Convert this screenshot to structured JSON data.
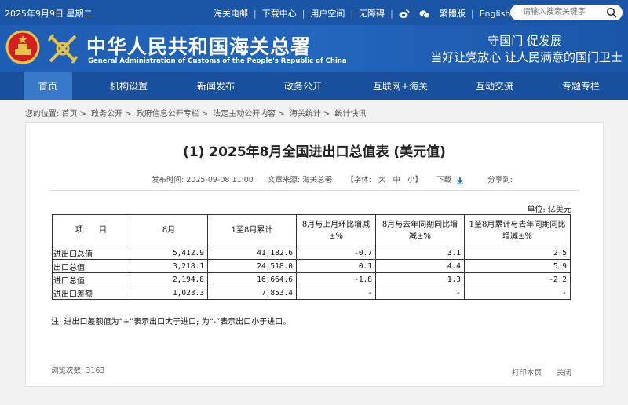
{
  "topbar": {
    "date": "2025年9月9日 星期二",
    "links": [
      "海关电邮",
      "下载中心",
      "用户空间",
      "无障碍"
    ],
    "lang_label": "繁體版",
    "english_label": "English",
    "search_placeholder": "请输入搜索关键字"
  },
  "header": {
    "title_cn": "中华人民共和国海关总署",
    "title_en": "General Administration of Customs of the People's Republic of China",
    "slogan_line1": "守国门  促发展",
    "slogan_line2": "当好让党放心  让人民满意的国门卫士"
  },
  "nav": {
    "items": [
      "首页",
      "机构设置",
      "新闻发布",
      "政务公开",
      "互联网+海关",
      "互动交流",
      "专题专栏"
    ]
  },
  "breadcrumb": {
    "prefix": "您的位置:",
    "items": [
      "首页",
      "政务公开",
      "政府信息公开专栏",
      "法定主动公开内容",
      "海关统计",
      "统计快讯"
    ]
  },
  "article": {
    "title": "(1) 2025年8月全国进出口总值表 (美元值)",
    "publish_time_label": "发布时间:",
    "publish_time": "2025-09-08 11:00",
    "source_label": "文章来源:",
    "source": "海关总署",
    "font_size_label": "【字体:",
    "font_large": "大",
    "font_medium": "中",
    "font_small": "小】",
    "download_label": "下载",
    "share_label": "分享到:"
  },
  "table": {
    "unit": "单位: 亿美元",
    "headers": [
      "项　　目",
      "8月",
      "1至8月累计",
      "8月与上月环比增减±%",
      "8月与去年同期同比增减±%",
      "1至8月累计与去年同期同比增减±%"
    ],
    "rows": [
      {
        "label": "进出口总值",
        "aug": "5,412.9",
        "ytd": "41,182.6",
        "mom": "-0.7",
        "yoy": "3.1",
        "ytd_yoy": "2.5"
      },
      {
        "label": "出口总值",
        "aug": "3,218.1",
        "ytd": "24,518.0",
        "mom": "0.1",
        "yoy": "4.4",
        "ytd_yoy": "5.9"
      },
      {
        "label": "进口总值",
        "aug": "2,194.8",
        "ytd": "16,664.6",
        "mom": "-1.8",
        "yoy": "1.3",
        "ytd_yoy": "-2.2"
      },
      {
        "label": "进出口差额",
        "aug": "1,023.3",
        "ytd": "7,853.4",
        "mom": "-",
        "yoy": "-",
        "ytd_yoy": "-"
      }
    ],
    "note": "注: 进出口差额值为“+”表示出口大于进口; 为“-”表示出口小于进口。"
  },
  "footer": {
    "views_label": "浏览次数:",
    "views": "3163",
    "print_label": "打印本页",
    "close_label": "关闭"
  }
}
